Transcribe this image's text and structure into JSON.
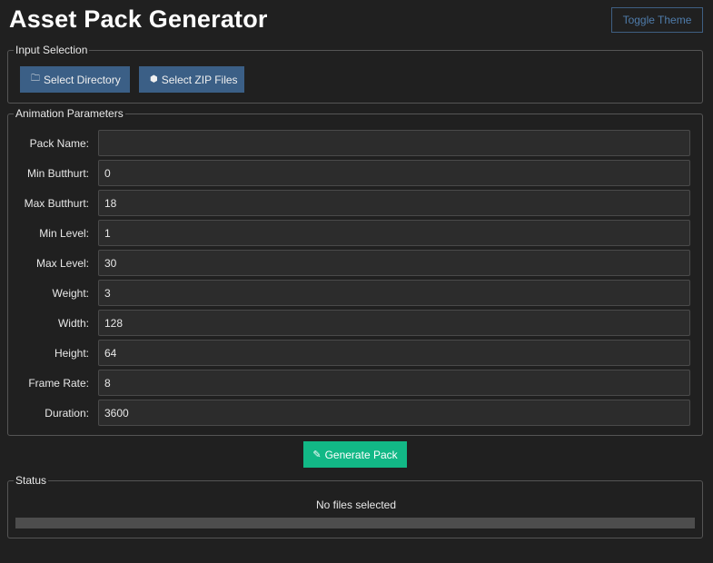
{
  "header": {
    "title": "Asset Pack Generator",
    "toggle_theme": "Toggle Theme"
  },
  "input_selection": {
    "legend": "Input Selection",
    "select_directory": "Select Directory",
    "select_zip": "Select ZIP Files",
    "folder_glyph": "🗀",
    "package_glyph": "⬢"
  },
  "animation": {
    "legend": "Animation Parameters",
    "fields": [
      {
        "label": "Pack Name:",
        "value": ""
      },
      {
        "label": "Min Butthurt:",
        "value": "0"
      },
      {
        "label": "Max Butthurt:",
        "value": "18"
      },
      {
        "label": "Min Level:",
        "value": "1"
      },
      {
        "label": "Max Level:",
        "value": "30"
      },
      {
        "label": "Weight:",
        "value": "3"
      },
      {
        "label": "Width:",
        "value": "128"
      },
      {
        "label": "Height:",
        "value": "64"
      },
      {
        "label": "Frame Rate:",
        "value": "8"
      },
      {
        "label": "Duration:",
        "value": "3600"
      }
    ]
  },
  "generate": {
    "label": "Generate Pack",
    "glyph": "✎"
  },
  "status": {
    "legend": "Status",
    "text": "No files selected",
    "progress": 0
  },
  "colors": {
    "background": "#202020",
    "primary_button": "#3b5f86",
    "accent": "#12b886",
    "toggle_border": "#3f5f82"
  }
}
